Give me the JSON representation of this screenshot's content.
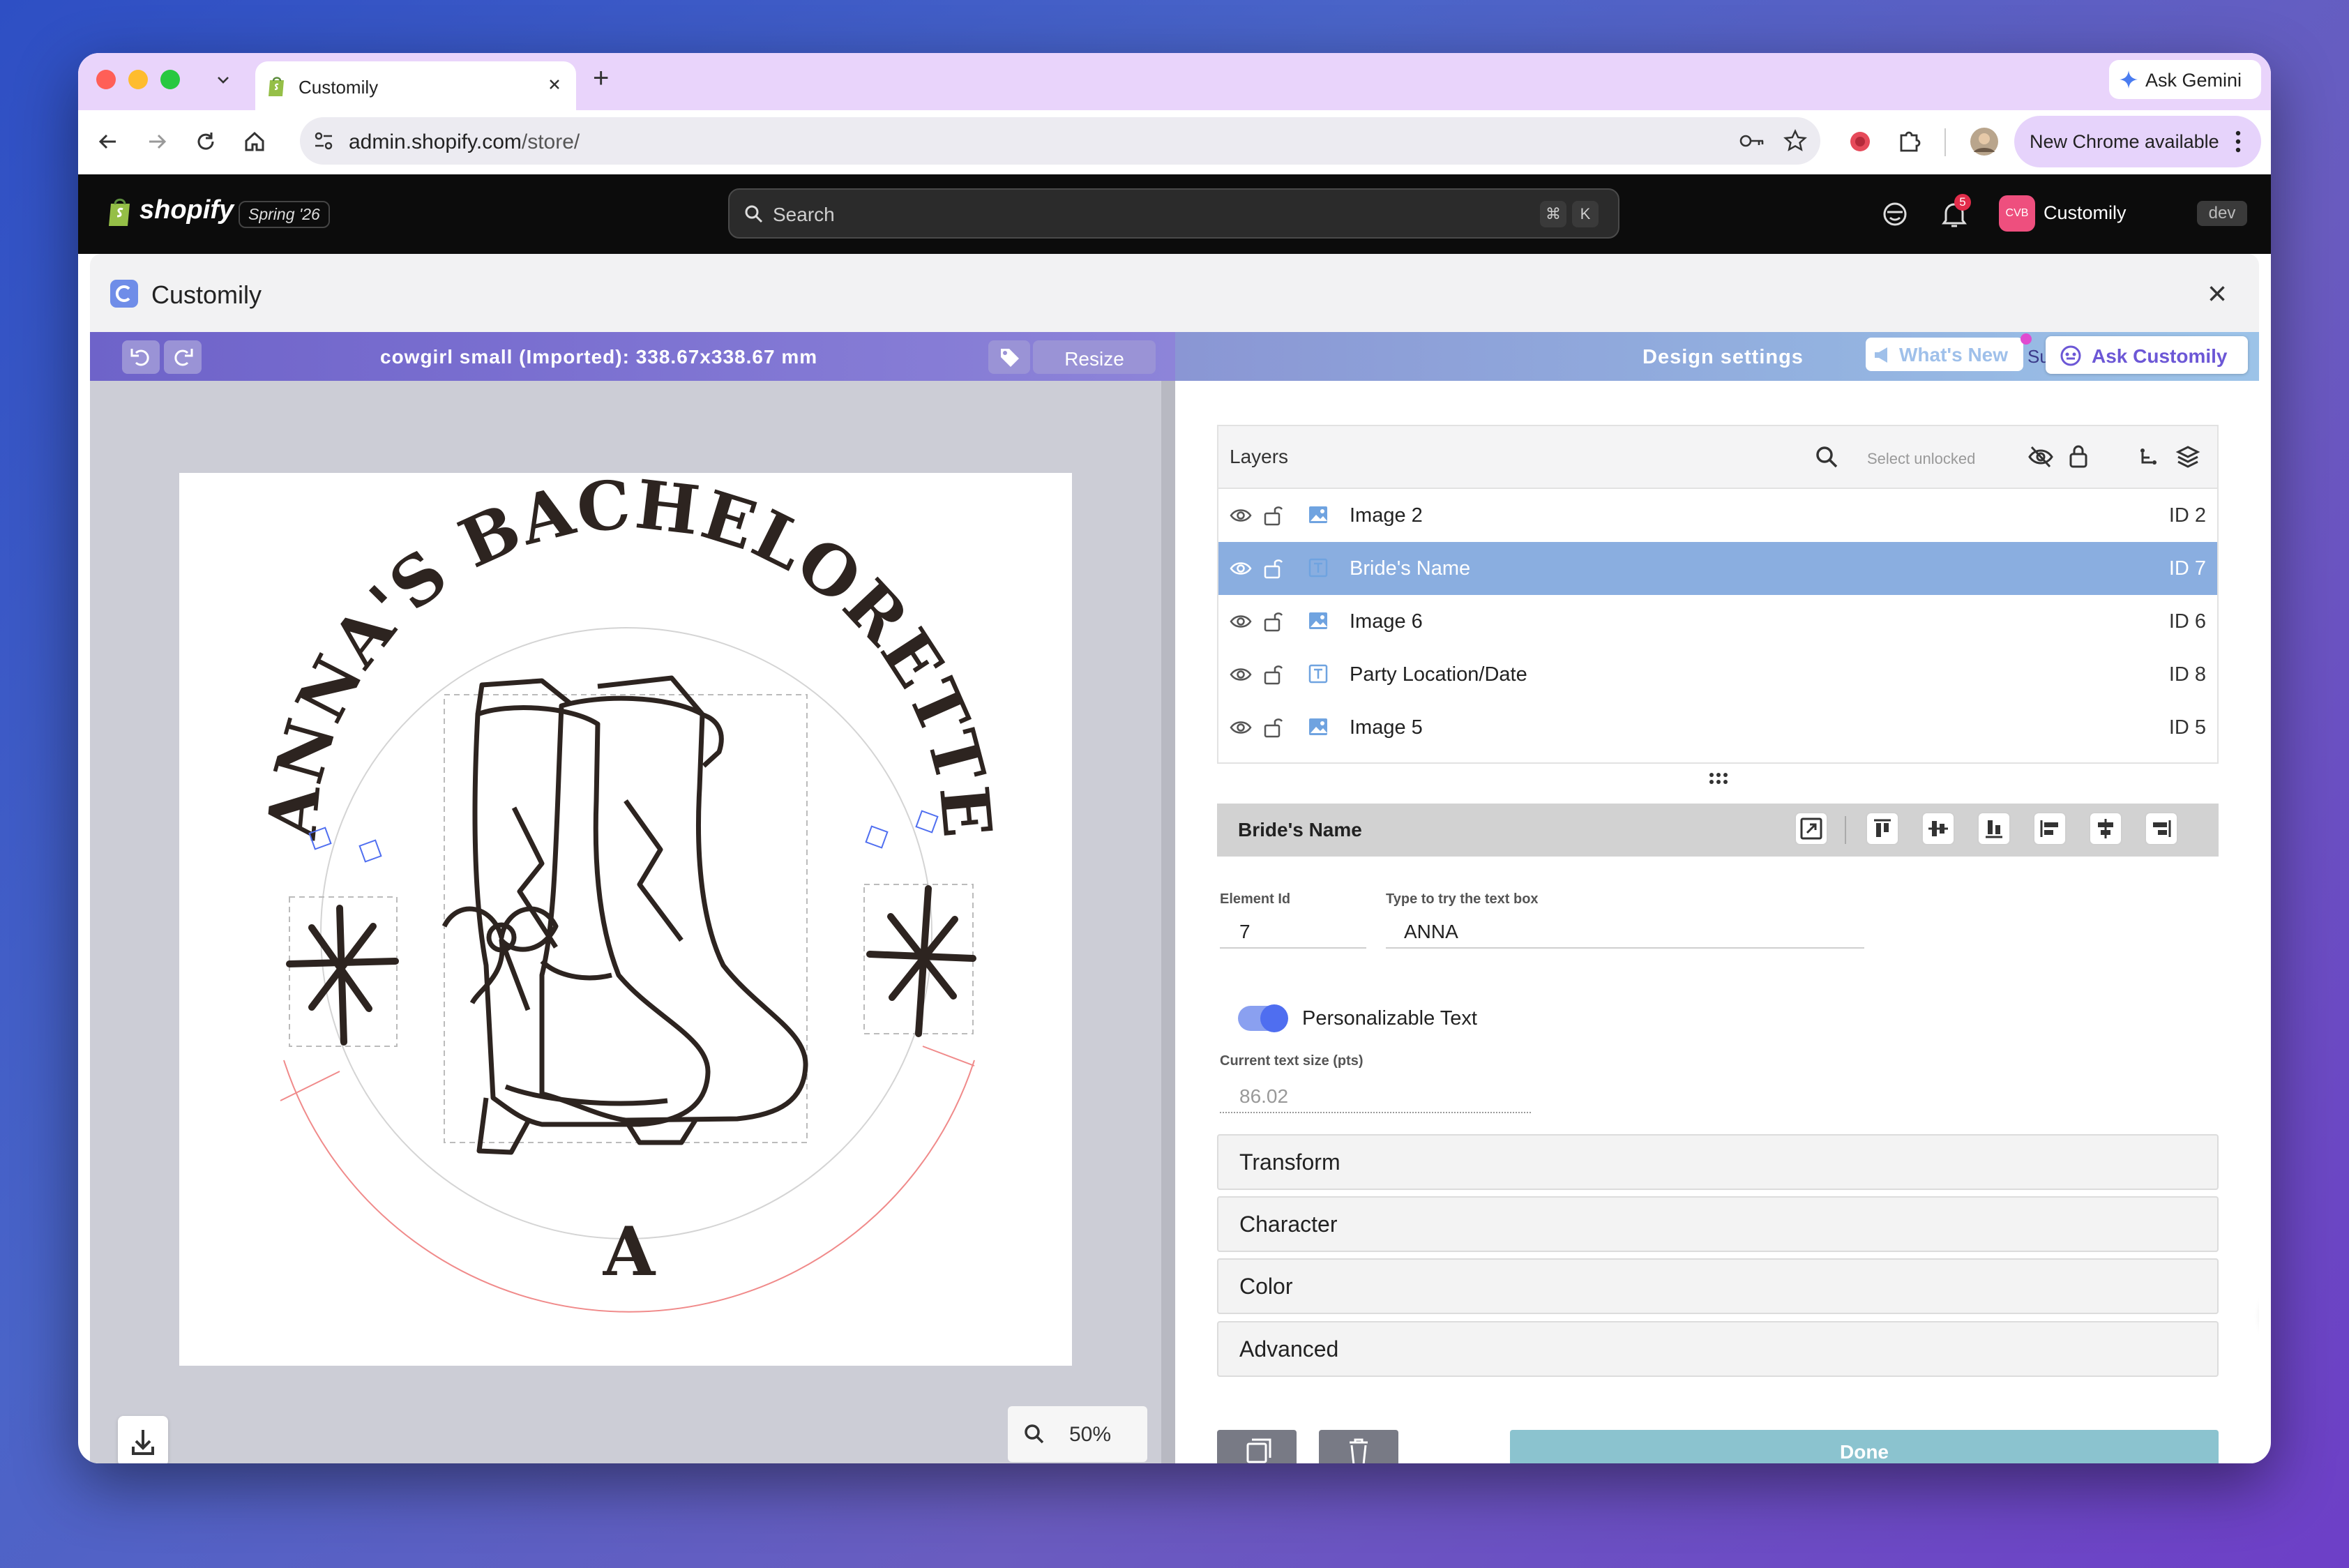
{
  "browser": {
    "tab_title": "Customily",
    "new_tab": "+",
    "ask_gemini": "Ask Gemini",
    "url_host": "admin.shopify.com",
    "url_path": "/store/",
    "update_label": "New Chrome available"
  },
  "shopify": {
    "logo_text": "shopify",
    "edition": "Spring '26",
    "search_placeholder": "Search",
    "shortcut_cmd": "⌘",
    "shortcut_key": "K",
    "notifications_count": "5",
    "store_avatar": "CVB",
    "store_name": "Customily",
    "dev_badge": "dev"
  },
  "app": {
    "title": "Customily",
    "close": "×"
  },
  "editor": {
    "product_title": "cowgirl small (Imported): 338.67x338.67 mm",
    "resize_label": "Resize",
    "zoom": "50%",
    "design_text_arc": "ANNA'S BACHELORETTE",
    "design_letter": "A"
  },
  "settings": {
    "header": "Design settings",
    "whats_new": "What's New",
    "whats_new_clip": "Su",
    "ask_customily": "Ask Customily",
    "layers_label": "Layers",
    "select_unlocked": "Select unlocked",
    "layers": [
      {
        "name": "Image 2",
        "id": "ID 2",
        "kind": "image",
        "selected": false
      },
      {
        "name": "Bride's Name",
        "id": "ID 7",
        "kind": "text",
        "selected": true
      },
      {
        "name": "Image 6",
        "id": "ID 6",
        "kind": "image",
        "selected": false
      },
      {
        "name": "Party Location/Date",
        "id": "ID 8",
        "kind": "text",
        "selected": false
      },
      {
        "name": "Image 5",
        "id": "ID 5",
        "kind": "image",
        "selected": false
      }
    ],
    "element_title": "Bride's Name",
    "element_id_label": "Element Id",
    "element_id": "7",
    "try_label": "Type to try the text box",
    "try_value": "ANNA",
    "personalizable_label": "Personalizable Text",
    "personalizable_on": true,
    "text_size_label": "Current text size (pts)",
    "text_size": "86.02",
    "sections": [
      "Transform",
      "Character",
      "Color",
      "Advanced"
    ],
    "done_label": "Done"
  },
  "colors": {
    "accent_purple": "#7a6fd0",
    "selected_row": "#8aaee0",
    "toggle": "#4f6ef0",
    "done": "#8bc3cf",
    "shopify_bar": "#0c0c0c",
    "guide_red": "#f08a8a"
  }
}
